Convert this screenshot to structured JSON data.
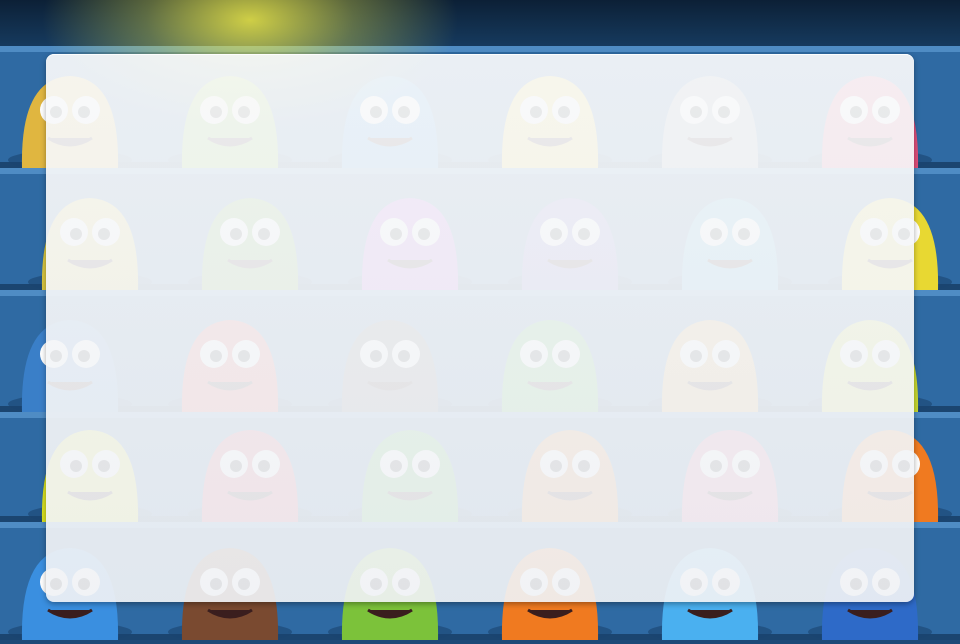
{
  "scene": {
    "type": "monster-grid-background",
    "shelf_rows": 5,
    "monsters_per_row": 6,
    "colors": {
      "shelf": "#2f6aa3",
      "shelf_dark": "#1b4570",
      "shelf_light": "#4f8cc4",
      "glow": "#f0eb46",
      "panel": "#f5f6f8"
    },
    "monster_colors": [
      [
        "#e0b640",
        "#7cc23a",
        "#2e8fe0",
        "#f2d23a",
        "#9aa3ad",
        "#e04e7a"
      ],
      [
        "#d9c640",
        "#5fa832",
        "#b44ae0",
        "#6a5fc8",
        "#3aa8d8",
        "#e8d832"
      ],
      [
        "#3a7fc8",
        "#e04040",
        "#5a5a62",
        "#3cb040",
        "#d8a040",
        "#c8d830"
      ],
      [
        "#d8e020",
        "#d83a5a",
        "#3cb040",
        "#e07a20",
        "#d85a8a",
        "#f07a20"
      ],
      [
        "#3a8fe0",
        "#7a4a30",
        "#7cc23a",
        "#f07a20",
        "#4ab0f0",
        "#2e6ac8"
      ]
    ]
  },
  "overlay": {
    "title": "",
    "message": ""
  }
}
